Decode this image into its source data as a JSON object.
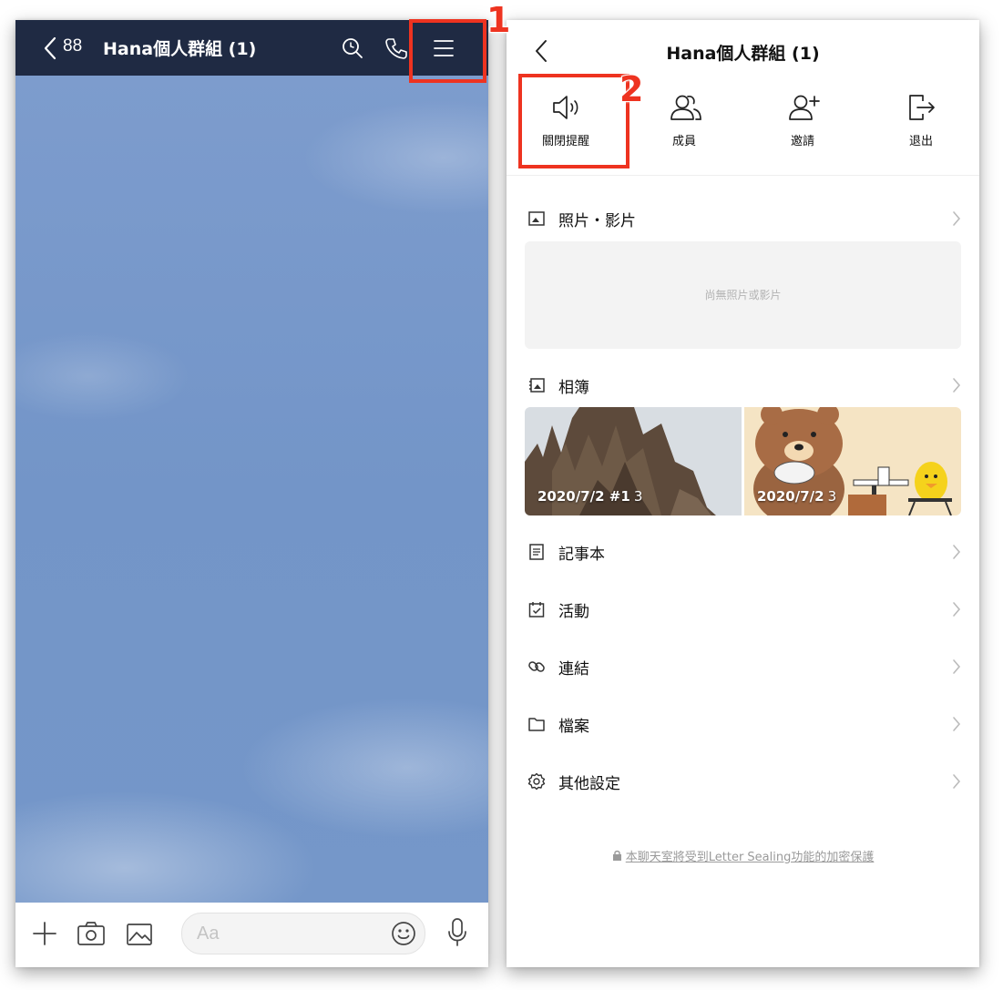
{
  "left": {
    "header": {
      "unread_count": "88",
      "title": "Hana個人群組 (1)"
    },
    "input": {
      "placeholder": "Aa"
    }
  },
  "right": {
    "header": {
      "title": "Hana個人群組 (1)"
    },
    "actions": [
      {
        "label": "關閉提醒",
        "icon": "speaker-icon"
      },
      {
        "label": "成員",
        "icon": "members-icon"
      },
      {
        "label": "邀請",
        "icon": "add-user-icon"
      },
      {
        "label": "退出",
        "icon": "exit-icon"
      }
    ],
    "photos": {
      "label": "照片・影片",
      "empty_text": "尚無照片或影片"
    },
    "album": {
      "label": "相簿",
      "items": [
        {
          "caption": "2020/7/2 #1",
          "count": "3"
        },
        {
          "caption": "2020/7/2",
          "count": "3"
        }
      ]
    },
    "menu": [
      {
        "label": "記事本",
        "icon": "note-icon"
      },
      {
        "label": "活動",
        "icon": "calendar-icon"
      },
      {
        "label": "連結",
        "icon": "link-icon"
      },
      {
        "label": "檔案",
        "icon": "folder-icon"
      },
      {
        "label": "其他設定",
        "icon": "gear-icon"
      }
    ],
    "footer": {
      "text": "本聊天室將受到Letter Sealing功能的加密保護"
    }
  },
  "annotations": {
    "step1": "1",
    "step2": "2",
    "color": "#ee3320"
  }
}
